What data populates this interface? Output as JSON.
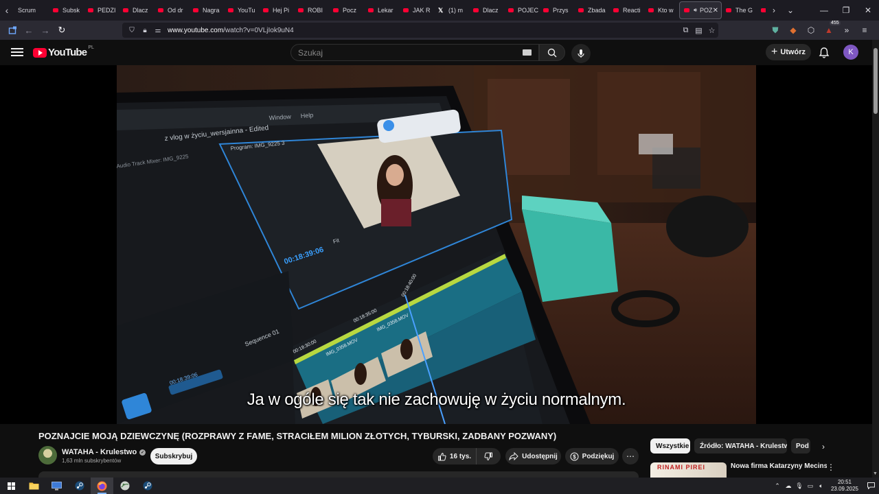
{
  "browser": {
    "tabs": [
      {
        "label": "Scrum",
        "favicon": "none"
      },
      {
        "label": "Subsk",
        "favicon": "youtube"
      },
      {
        "label": "PEDZI",
        "favicon": "youtube"
      },
      {
        "label": "Dlacz",
        "favicon": "youtube"
      },
      {
        "label": "Od dr",
        "favicon": "youtube"
      },
      {
        "label": "Nagra",
        "favicon": "youtube"
      },
      {
        "label": "YouTu",
        "favicon": "youtube"
      },
      {
        "label": "Hej Pi",
        "favicon": "youtube"
      },
      {
        "label": "ROBI",
        "favicon": "youtube"
      },
      {
        "label": "Pocz",
        "favicon": "youtube"
      },
      {
        "label": "Lekar",
        "favicon": "youtube"
      },
      {
        "label": "JAK R",
        "favicon": "youtube"
      },
      {
        "label": "(1) m",
        "favicon": "x"
      },
      {
        "label": "Dlacz",
        "favicon": "youtube"
      },
      {
        "label": "POJEC",
        "favicon": "youtube"
      },
      {
        "label": "Przys",
        "favicon": "youtube"
      },
      {
        "label": "Zbada",
        "favicon": "youtube"
      },
      {
        "label": "Reacti",
        "favicon": "youtube"
      },
      {
        "label": "Kto w",
        "favicon": "youtube"
      }
    ],
    "active_tab": {
      "label": "POZ",
      "playing_audio": true
    },
    "trailing_tabs": [
      {
        "label": "The G",
        "favicon": "youtube"
      },
      {
        "label": "",
        "favicon": "youtube"
      }
    ],
    "address": {
      "domain": "www.youtube.com",
      "path": "/watch?v=0VLjIok9uN4"
    },
    "extension_badge": "455",
    "accent": "#ff0033"
  },
  "youtube": {
    "logo_text": "YouTube",
    "country_code": "PL",
    "search_placeholder": "Szukaj",
    "create_label": "Utwórz",
    "avatar_letter": "K",
    "avatar_color": "#7e57c2"
  },
  "video": {
    "subtitle": "Ja w ogóle się tak nie zachowuję w życiu normalnym.",
    "screen_text": {
      "menu_window": "Window",
      "menu_help": "Help",
      "project": "z vlog w życiu_wersjainna - Edited",
      "program": "Program: IMG_9225 3",
      "timecode": "00:18:39:06",
      "fit": "Fit",
      "sequence": "Sequence 01",
      "clip_a": "IMG_0358.MOV",
      "clip_b": "IMG_0358.MOV",
      "ruler_a": "00:18:30:00",
      "ruler_b": "00:18:35:00",
      "ruler_c": "00:18:40:00",
      "source": "Audio Track Mixer: IMG_9225",
      "timeline_timecode": "00:18:39:06"
    }
  },
  "details": {
    "title": "POZNAJCIE MOJĄ DZIEWCZYNĘ (ROZPRAWY Z FAME, STRACIŁEM MILION ZŁOTYCH, TYBURSKI, ZADBANY POZWANY)",
    "channel_name": "WATAHA - Krulestwo",
    "subscribers": "1,63 mln subskrybentów",
    "subscribe_label": "Subskrybuj",
    "likes": "16 tys.",
    "share_label": "Udostępnij",
    "thanks_label": "Podziękuj"
  },
  "sidebar": {
    "chips": [
      "Wszystkie",
      "Źródło: WATAHA - Krulestwo",
      "Pod"
    ],
    "recommended": [
      {
        "title": "Nowa firma Katarzyny Mecinski",
        "thumb_text": "RINAMI PIREI"
      }
    ]
  },
  "taskbar": {
    "time": "20:51",
    "date": "23.09.2025"
  }
}
